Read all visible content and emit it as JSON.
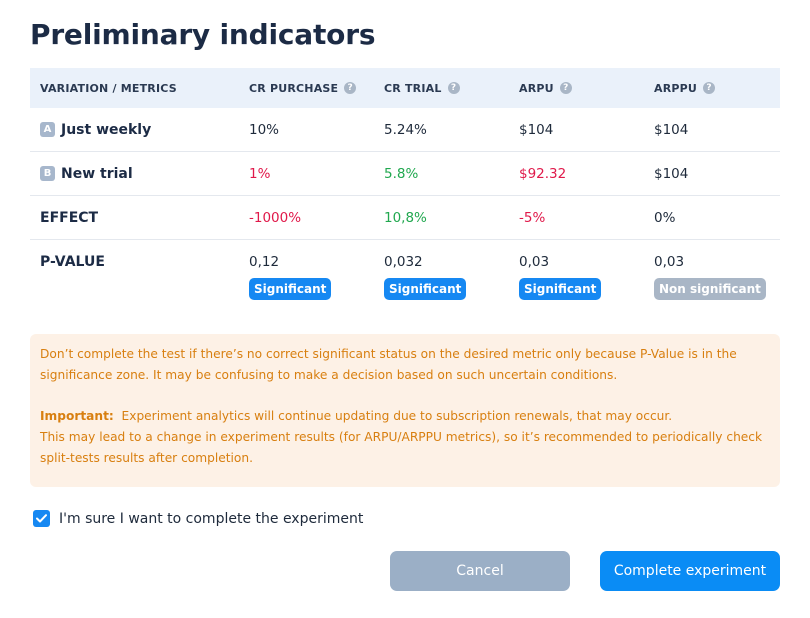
{
  "title": "Preliminary indicators",
  "table": {
    "headers": [
      "VARIATION / METRICS",
      "CR PURCHASE",
      "CR TRIAL",
      "ARPU",
      "ARPPU"
    ],
    "help_icon": "?",
    "rows": [
      {
        "letter": "A",
        "label": "Just weekly",
        "values": [
          "10%",
          "5.24%",
          "$104",
          "$104"
        ]
      },
      {
        "letter": "B",
        "label": "New trial",
        "values": [
          "1%",
          "5.8%",
          "$92.32",
          "$104"
        ]
      },
      {
        "label": "EFFECT",
        "values": [
          "-1000%",
          "10,8%",
          "-5%",
          "0%"
        ]
      },
      {
        "label": "P-VALUE",
        "values": [
          "0,12",
          "0,032",
          "0,03",
          "0,03"
        ],
        "statuses": [
          "Significant",
          "Significant",
          "Significant",
          "Non significant"
        ]
      }
    ]
  },
  "notice": {
    "line1": "Don’t complete the test if there’s no correct significant status on the desired metric only because P-Value is in the significance zone. It may be confusing to make a decision based on such uncertain conditions.",
    "important_label": "Important:",
    "important_text": "Experiment analytics will continue updating due to subscription renewals, that may occur.",
    "line3": "This may lead to a change in experiment results (for ARPU/ARPPU metrics), so it’s recommended to periodically check split-tests results after completion."
  },
  "confirm": {
    "checked": true,
    "label": "I'm sure I want to complete the experiment"
  },
  "buttons": {
    "cancel": "Cancel",
    "complete": "Complete experiment"
  },
  "colors": {
    "accent": "#1688f2",
    "negative": "#e0194a",
    "positive": "#21a84f",
    "warning_text": "#d87f10",
    "warning_bg": "#fdf1e6"
  }
}
